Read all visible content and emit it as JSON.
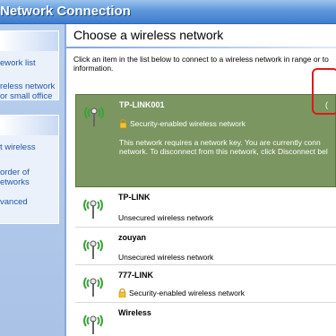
{
  "window": {
    "title": "Network Connection"
  },
  "sidebar": {
    "groups": [
      {
        "header": "ks",
        "items": [
          "ework list",
          "reless network",
          "or small office"
        ]
      },
      {
        "header": "ks",
        "items": [
          "t wireless",
          "order of",
          "etworks",
          "vanced"
        ]
      }
    ]
  },
  "main": {
    "heading": "Choose a wireless network",
    "instructions": [
      "Click an item in the list below to connect to a wireless network in range or to",
      "information."
    ]
  },
  "networks": [
    {
      "name": "TP-LINK001",
      "status": "Security-enabled wireless network",
      "secured": true,
      "selected": true,
      "description": [
        "This network requires a network key. You are currently conn",
        "network. To disconnect from this network, click Disconnect bel"
      ],
      "signal": "("
    },
    {
      "name": "TP-LINK",
      "status": "Unsecured wireless network",
      "secured": false,
      "selected": false
    },
    {
      "name": "zouyan",
      "status": "Unsecured wireless network",
      "secured": false,
      "selected": false
    },
    {
      "name": "777-LINK",
      "status": "Security-enabled wireless network",
      "secured": true,
      "selected": false
    },
    {
      "name": "Wireless",
      "status": "",
      "secured": false,
      "selected": false
    }
  ],
  "colors": {
    "titlebar": "#5f98dc",
    "selected_row": "#7b9660",
    "highlight_box": "#e01818",
    "task_link": "#1f55a8"
  }
}
